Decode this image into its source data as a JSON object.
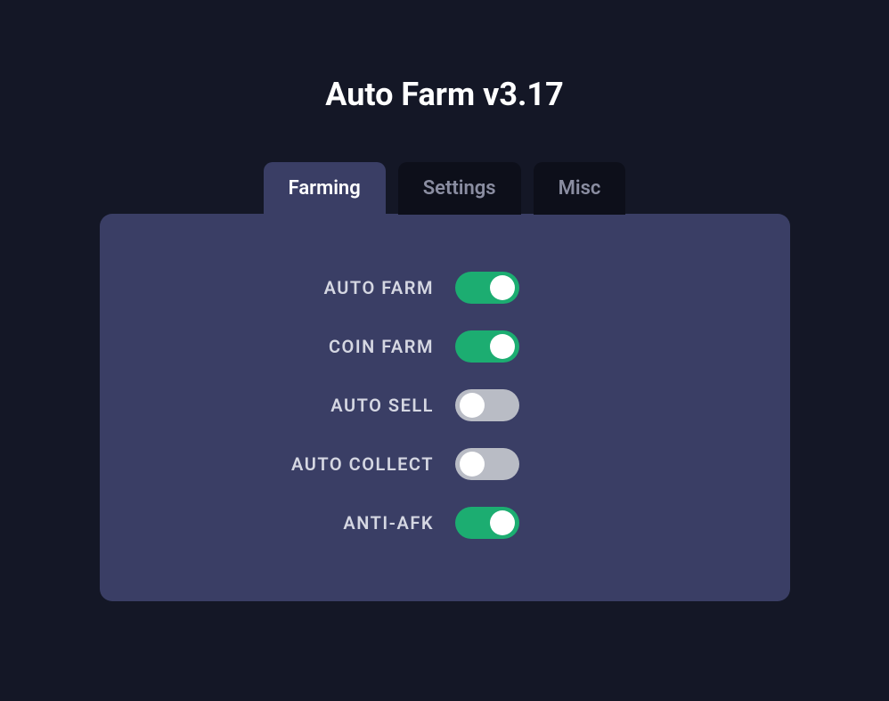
{
  "title": "Auto Farm v3.17",
  "tabs": [
    {
      "label": "Farming",
      "active": true
    },
    {
      "label": "Settings",
      "active": false
    },
    {
      "label": "Misc",
      "active": false
    }
  ],
  "toggles": [
    {
      "label": "AUTO FARM",
      "on": true
    },
    {
      "label": "COIN FARM",
      "on": true
    },
    {
      "label": "AUTO SELL",
      "on": false
    },
    {
      "label": "AUTO COLLECT",
      "on": false
    },
    {
      "label": "ANTI-AFK",
      "on": true
    }
  ]
}
